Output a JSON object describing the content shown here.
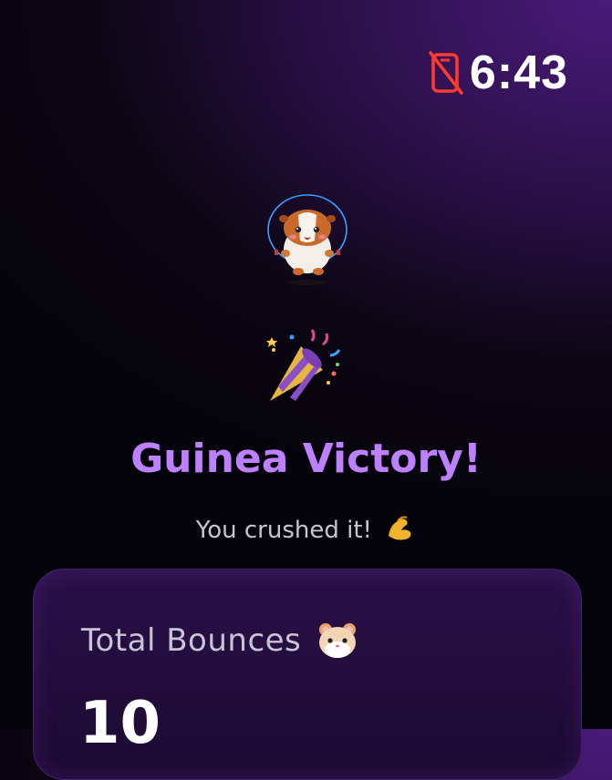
{
  "status": {
    "time": "6:43",
    "icons": [
      "phone-off-icon"
    ],
    "accent_color": "#ff3b30"
  },
  "mascot": {
    "icon": "guinea-pig-jump-rope-icon"
  },
  "celebration": {
    "icon": "party-popper-icon"
  },
  "result": {
    "title": "Guinea Victory!",
    "subtitle": "You crushed it!",
    "subtitle_icon": "flexed-biceps-icon",
    "title_color": "#bd80ff"
  },
  "stats": {
    "label": "Total Bounces",
    "label_icon": "hamster-face-icon",
    "value": "10"
  }
}
